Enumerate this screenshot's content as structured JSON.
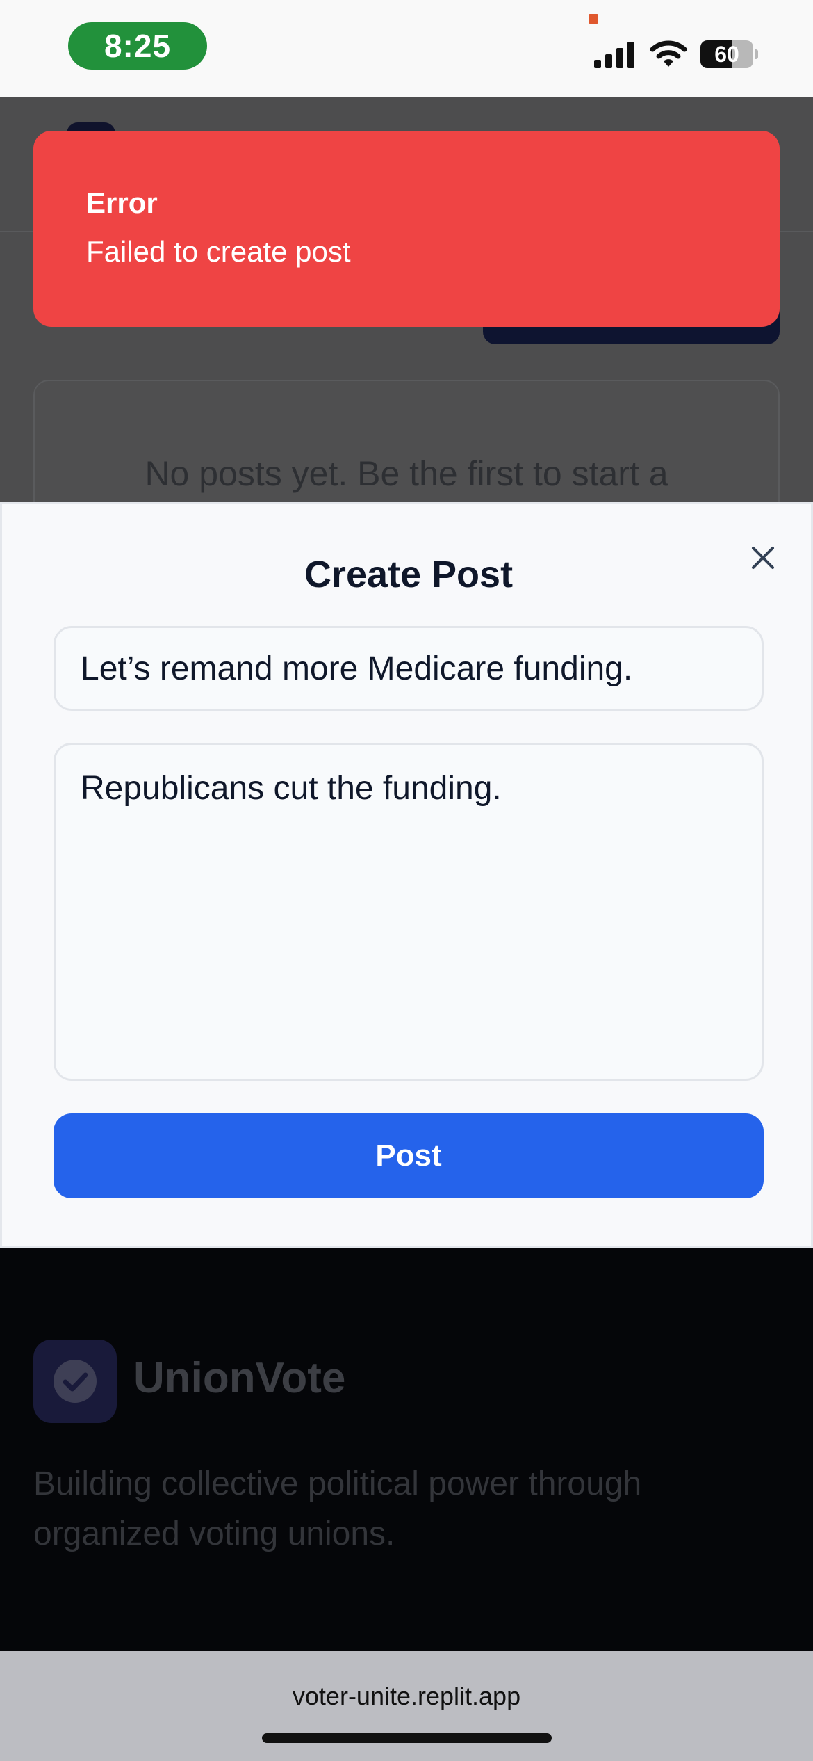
{
  "status_bar": {
    "time": "8:25",
    "battery_percent": 60,
    "battery_label": "60",
    "icons": [
      "signal-icon",
      "wifi-icon",
      "battery-icon"
    ]
  },
  "background_page": {
    "empty_state": "No posts yet. Be the first to start a"
  },
  "toast": {
    "title": "Error",
    "description": "Failed to create post",
    "color": "#ef4444"
  },
  "create_post": {
    "title": "Create Post",
    "close_icon": "close-icon",
    "title_value": "Let’s remand more Medicare funding.",
    "body_value": "Republicans cut the funding.",
    "submit_label": "Post",
    "accent": "#2563eb"
  },
  "footer": {
    "brand": "UnionVote",
    "tagline": "Building collective political power through organized voting unions.",
    "logo_icon": "check-circle-icon"
  },
  "browser": {
    "url": "voter-unite.replit.app"
  }
}
